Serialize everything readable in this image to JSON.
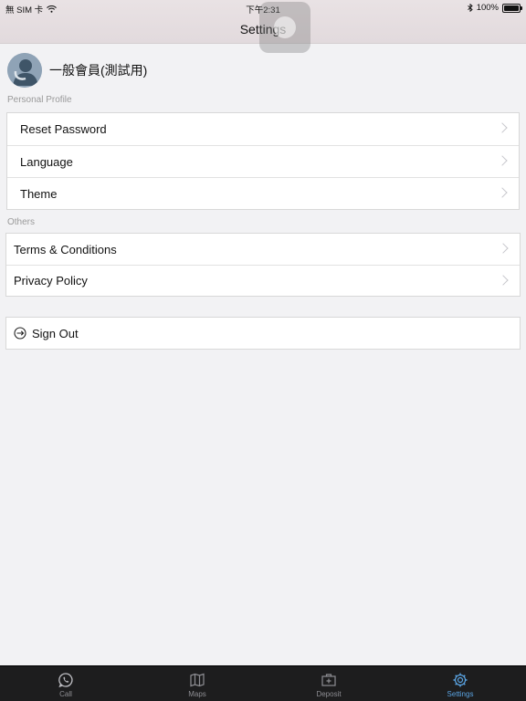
{
  "status": {
    "carrier": "無 SIM 卡",
    "time": "下午2:31",
    "battery": "100%"
  },
  "nav": {
    "title": "Settings"
  },
  "profile": {
    "name": "一般會員(測試用)"
  },
  "sections": {
    "personal": {
      "label": "Personal Profile",
      "items": [
        "Reset Password",
        "Language",
        "Theme"
      ]
    },
    "others": {
      "label": "Others",
      "items": [
        "Terms & Conditions",
        "Privacy Policy"
      ]
    }
  },
  "signout": {
    "label": "Sign Out"
  },
  "tabs": [
    {
      "label": "Call",
      "icon": "whatsapp-phone-icon"
    },
    {
      "label": "Maps",
      "icon": "map-icon"
    },
    {
      "label": "Deposit",
      "icon": "deposit-box-icon"
    },
    {
      "label": "Settings",
      "icon": "gear-icon"
    }
  ],
  "colors": {
    "accent": "#5aa4e3",
    "tabbar": "#1d1d1e"
  }
}
